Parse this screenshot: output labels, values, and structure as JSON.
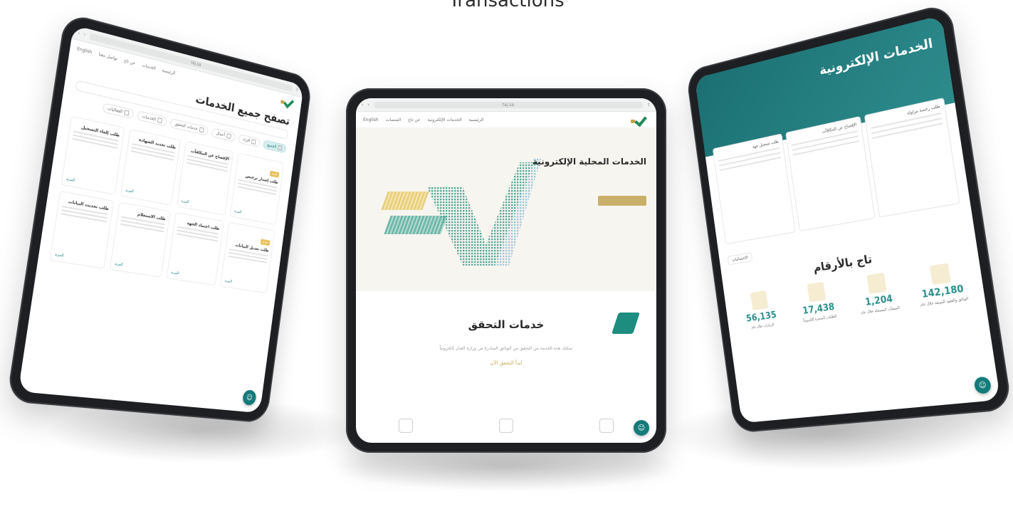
{
  "caption": "Transactions",
  "left_tablet": {
    "browser_url": "taj.sa",
    "nav_links": [
      "الرئيسية",
      "الخدمات",
      "عن تاج",
      "تواصل معنا",
      "English"
    ],
    "page_title": "تصفح جميع الخدمات",
    "filters": [
      {
        "label": "الجميع",
        "active": true
      },
      {
        "label": "أفراد",
        "active": false
      },
      {
        "label": "أعمال",
        "active": false
      },
      {
        "label": "خدمات التحقق",
        "active": false
      },
      {
        "label": "الخدمات",
        "active": false
      },
      {
        "label": "الفعاليات",
        "active": false
      }
    ],
    "cards": [
      {
        "tag": "جديد",
        "title": "طلب إصدار ترخيص",
        "more": "المزيد"
      },
      {
        "tag": "",
        "title": "الإفصاح عن المكافآت",
        "more": "المزيد"
      },
      {
        "tag": "",
        "title": "طلب تجديد الشهادة",
        "more": "المزيد"
      },
      {
        "tag": "",
        "title": "طلب إلغاء التسجيل",
        "more": "المزيد"
      },
      {
        "tag": "جديد",
        "title": "طلب تعديل البيانات",
        "more": "المزيد"
      },
      {
        "tag": "",
        "title": "طلب اعتماد الجهة",
        "more": "المزيد"
      },
      {
        "tag": "",
        "title": "طلب الاستعلام",
        "more": "المزيد"
      },
      {
        "tag": "",
        "title": "طلب تحديث البيانات",
        "more": "المزيد"
      }
    ]
  },
  "center_tablet": {
    "browser_url": "taj.sa",
    "nav_links": [
      "الرئيسية",
      "الخدمات الإلكترونية",
      "عن تاج",
      "المنصات",
      "English"
    ],
    "hero_title": "الخدمات المحلية الإلكترونية",
    "verify_title": "خدمات التحقق",
    "verify_desc": "تمكنك هذه الخدمة من التحقق من الوثائق الصادرة من وزارة العدل إلكترونياً",
    "verify_link": "ابدأ التحقق الآن"
  },
  "right_tablet": {
    "header_title": "الخدمات الإلكترونية",
    "panels": [
      "طلب تسجيل جهة",
      "الإفصاح عن المكافآت",
      "طلب رخصة مزاولة"
    ],
    "section_label": "الإحصائيات",
    "stats_title": "تاج بالأرقام",
    "stats": [
      {
        "value": "142,180",
        "label": "الوثائق والعقود الموثقة خلال عام"
      },
      {
        "value": "1,204",
        "label": "المنشآت المسجلة خلال عام"
      },
      {
        "value": "17,438",
        "label": "الطلبات المنجزة إلكترونياً"
      },
      {
        "value": "56,135",
        "label": "الزيارات خلال عام"
      }
    ]
  },
  "colors": {
    "accent": "#157a7a",
    "gold": "#c9a64e",
    "green": "#1e8a55"
  }
}
